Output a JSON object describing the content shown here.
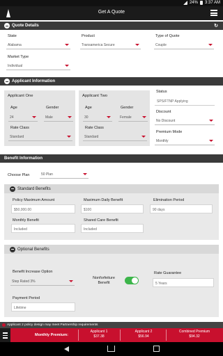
{
  "status_bar": {
    "battery": "24%",
    "time": "3:37 AM"
  },
  "app_bar": {
    "title": "Get A Quote"
  },
  "quote_details": {
    "header": "Quote Details",
    "state_label": "State",
    "state_value": "Alabama",
    "product_label": "Product",
    "product_value": "Transamerica Secure",
    "quote_type_label": "Type of Quote",
    "quote_type_value": "Couple",
    "market_type_label": "Market Type",
    "market_type_value": "Individual"
  },
  "applicant_info": {
    "header": "Applicant Information",
    "applicant_one": {
      "title": "Applicant One",
      "age_label": "Age",
      "age_value": "24",
      "gender_label": "Gender",
      "gender_value": "Male",
      "rate_class_label": "Rate Class",
      "rate_class_value": "Standard"
    },
    "applicant_two": {
      "title": "Applicant Two",
      "age_label": "Age",
      "age_value": "30",
      "gender_label": "Gender",
      "gender_value": "Female",
      "rate_class_label": "Rate Class",
      "rate_class_value": "Standard"
    },
    "status_label": "Status",
    "status_value": "SPS/FTNP Applying",
    "discount_label": "Discount",
    "discount_value": "No Discount",
    "premium_mode_label": "Premium Mode",
    "premium_mode_value": "Monthly"
  },
  "benefit_info": {
    "header": "Benefit Information",
    "choose_plan_label": "Choose Plan",
    "choose_plan_value": "50 Plan",
    "standard": {
      "header": "Standard Benefits",
      "policy_max_label": "Policy Maximum Amount",
      "policy_max_value": "$50,000.00",
      "max_daily_label": "Maximum Daily Benefit",
      "max_daily_value": "$100",
      "elimination_label": "Elimination Period",
      "elimination_value": "90 days",
      "monthly_label": "Monthly Benefit",
      "monthly_value": "Included",
      "shared_care_label": "Shared Care Benefit",
      "shared_care_value": "Included"
    },
    "optional": {
      "header": "Optional Benefits",
      "increase_label": "Benefit Increase Option",
      "increase_value": "Step Rated 3%",
      "nonforfeiture_label": "Nonforfeiture Benefit",
      "nonforfeiture_on": true,
      "rate_guarantee_label": "Rate Guarantee",
      "rate_guarantee_value": "5 Years",
      "payment_period_label": "Payment Period",
      "payment_period_value": "Lifetime"
    }
  },
  "alert": {
    "text": "Applicant 2 policy design may meet Partnership requirements"
  },
  "premium": {
    "title": "Monthly Premium:",
    "applicant1_label": "Applicant 1",
    "applicant1_value": "$37.38",
    "applicant2_label": "Applicant 2",
    "applicant2_value": "$56.94",
    "combined_label": "Combined Premium",
    "combined_value": "$94.32"
  },
  "colors": {
    "accent": "#c8102e",
    "header_dark": "#3a3a3a",
    "toggle_on": "#3cb54a"
  }
}
